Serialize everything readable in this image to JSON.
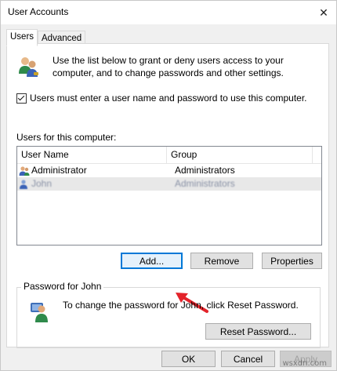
{
  "window": {
    "title": "User Accounts",
    "close_glyph": "✕"
  },
  "tabs": [
    {
      "label": "Users",
      "active": true
    },
    {
      "label": "Advanced",
      "active": false
    }
  ],
  "intro": {
    "text": "Use the list below to grant or deny users access to your computer, and to change passwords and other settings.",
    "icon": "users-group-icon"
  },
  "require_login": {
    "label": "Users must enter a user name and password to use this computer.",
    "checked": true
  },
  "users_list": {
    "label": "Users for this computer:",
    "columns": [
      "User Name",
      "Group"
    ],
    "rows": [
      {
        "name": "Administrator",
        "group": "Administrators",
        "selected": false
      },
      {
        "name": "John",
        "group": "Administrators",
        "selected": true
      }
    ]
  },
  "buttons": {
    "add": "Add...",
    "remove": "Remove",
    "properties": "Properties"
  },
  "password": {
    "group_title": "Password for John",
    "text": "To change the password for John, click Reset Password.",
    "reset_button": "Reset Password...",
    "icon": "user-key-icon"
  },
  "footer": {
    "ok": "OK",
    "cancel": "Cancel",
    "apply": "Apply"
  },
  "watermark": "wsxdn.com",
  "colors": {
    "accent": "#0078d7",
    "arrow": "#e3232a",
    "selection": "#e8e8e8"
  }
}
